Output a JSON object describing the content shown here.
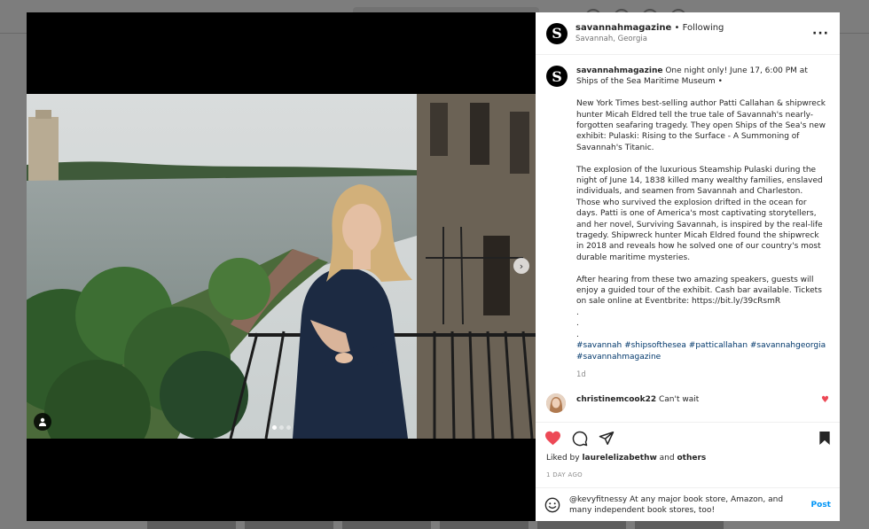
{
  "post": {
    "username": "savannahmagazine",
    "follow_sep": "•",
    "follow_status": "Following",
    "location": "Savannah, Georgia",
    "avatar_letter": "S",
    "more_icon": "more-horizontal-icon"
  },
  "caption": {
    "username": "savannahmagazine",
    "intro": "One night only! June 17, 6:00 PM at Ships of the Sea Maritime Museum •",
    "paragraphs": [
      "New York Times best-selling author Patti Callahan & shipwreck hunter Micah Eldred tell the true tale of Savannah's nearly-forgotten seafaring tragedy. They open Ships of the Sea's new exhibit: Pulaski: Rising to the Surface - A Summoning of Savannah's Titanic.",
      "The explosion of the luxurious Steamship Pulaski during the night of June 14, 1838 killed many wealthy families, enslaved individuals, and seamen from Savannah and Charleston. Those who survived the explosion drifted in the ocean for days. Patti is one of America's most captivating storytellers, and her novel, Surviving Savannah, is inspired by the real-life tragedy. Shipwreck hunter Micah Eldred found the shipwreck in 2018 and reveals how he solved one of our country's most durable maritime mysteries.",
      "After hearing from these two amazing speakers, guests will enjoy a guided tour of the exhibit. Cash bar available. Tickets on sale online at Eventbrite: https://bit.ly/39cRsmR"
    ],
    "dots": [
      ".",
      ".",
      "."
    ],
    "hashtags": "#savannah #shipsofthesea #patticallahan #savannahgeorgia #savannahmagazine",
    "age": "1d"
  },
  "comments": [
    {
      "username": "christinemcook22",
      "text": "Can't wait",
      "liked": true
    }
  ],
  "likes": {
    "prefix": "Liked by",
    "username": "laurelelizabethw",
    "and": "and",
    "others": "others"
  },
  "date": "1 DAY AGO",
  "composer": {
    "text": "@kevyfitnessy At any major book store, Amazon, and many independent book stores, too!",
    "post_label": "Post"
  },
  "colors": {
    "like_red": "#ed4956",
    "link_blue": "#0095f6",
    "hashtag_blue": "#00376b"
  },
  "carousel": {
    "current": 1,
    "total": 3
  }
}
